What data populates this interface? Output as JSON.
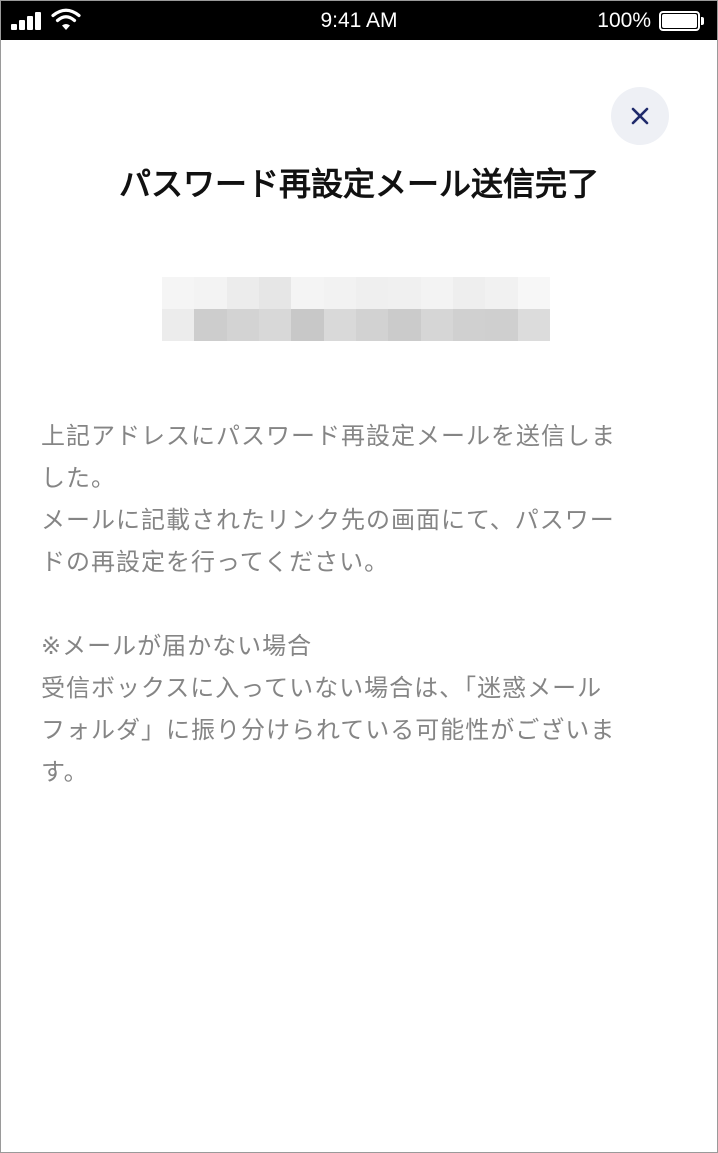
{
  "status_bar": {
    "time": "9:41 AM",
    "battery_percent": "100%",
    "battery_level": 1.0,
    "signal_icon": "cellular-signal-icon",
    "wifi_icon": "wifi-icon",
    "battery_icon": "battery-icon"
  },
  "dialog": {
    "close_icon": "close-icon",
    "title": "パスワード再設定メール送信完了",
    "message_lines": [
      "上記アドレスにパスワード再設定メールを送信しま\nした。\nメールに記載されたリンク先の画面にて、パスワー\nドの再設定を行ってください。"
    ],
    "notice_heading": "※メールが届かない場合",
    "notice_body": "受信ボックスに入っていない場合は、「迷惑メール\nフォルダ」に振り分けられている可能性がございま\nす。"
  },
  "colors": {
    "status_bar_bg": "#000000",
    "close_button_bg": "#eef0f5",
    "close_icon": "#1f2a6b",
    "title_text": "#111111",
    "body_text": "#858585"
  }
}
